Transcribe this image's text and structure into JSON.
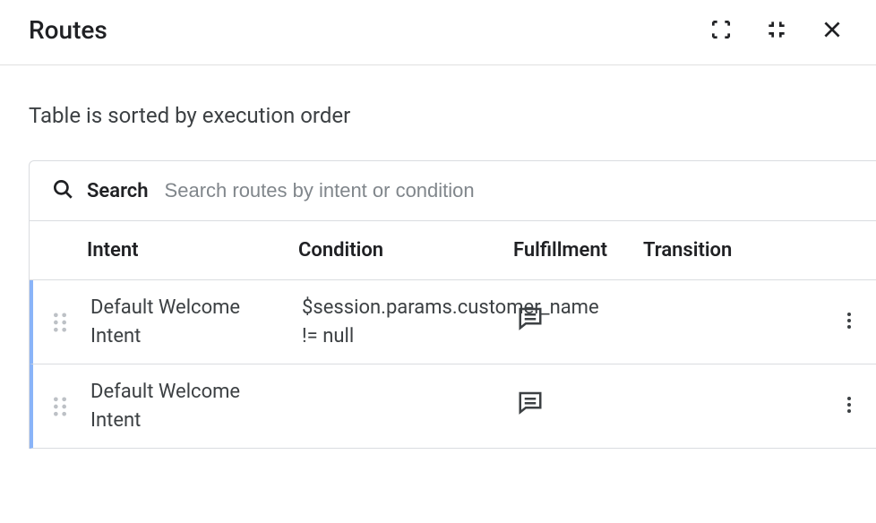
{
  "header": {
    "title": "Routes"
  },
  "subtitle": "Table is sorted by execution order",
  "search": {
    "label": "Search",
    "placeholder": "Search routes by intent or condition"
  },
  "columns": {
    "intent": "Intent",
    "condition": "Condition",
    "fulfillment": "Fulfillment",
    "transition": "Transition"
  },
  "rows": [
    {
      "intent": "Default Welcome Intent",
      "condition": "$session.params.customer_name != null",
      "fulfillment_icon": "chat-icon",
      "transition": ""
    },
    {
      "intent": "Default Welcome Intent",
      "condition": "",
      "fulfillment_icon": "chat-icon",
      "transition": ""
    }
  ]
}
